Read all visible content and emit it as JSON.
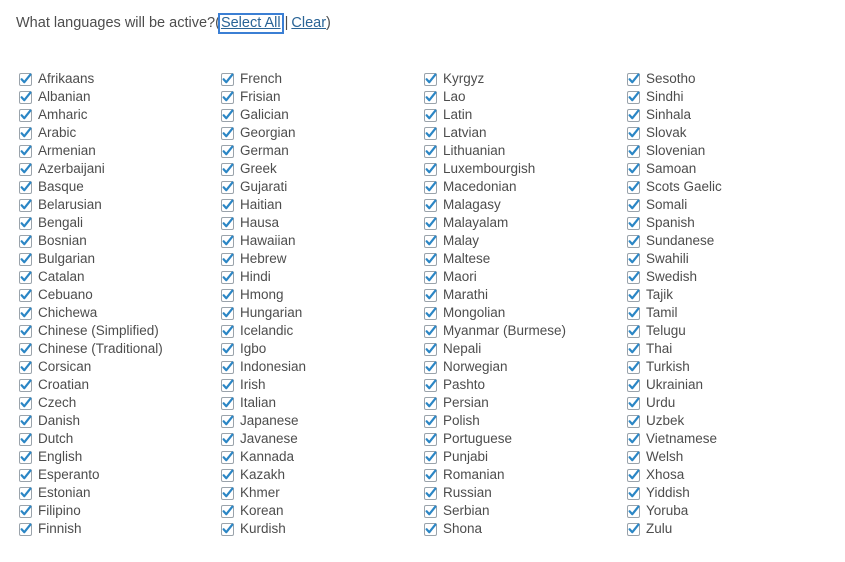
{
  "prompt": {
    "question": "What languages will be active?",
    "open_paren": "(",
    "select_all_label": "Select All",
    "separator": "|",
    "clear_label": "Clear",
    "close_paren": ")"
  },
  "colors": {
    "link": "#2a6496",
    "text": "#4d4d4d",
    "checkmark": "#2b86c5",
    "checkbox_border": "#9aa3ab",
    "focus_ring": "#3b7fd4",
    "background": "#ffffff"
  },
  "checkbox_state": {
    "checked": true,
    "icon": "checkmark-icon"
  },
  "columns": [
    {
      "index": 0,
      "items": [
        {
          "label": "Afrikaans",
          "checked": true
        },
        {
          "label": "Albanian",
          "checked": true
        },
        {
          "label": "Amharic",
          "checked": true
        },
        {
          "label": "Arabic",
          "checked": true
        },
        {
          "label": "Armenian",
          "checked": true
        },
        {
          "label": "Azerbaijani",
          "checked": true
        },
        {
          "label": "Basque",
          "checked": true
        },
        {
          "label": "Belarusian",
          "checked": true
        },
        {
          "label": "Bengali",
          "checked": true
        },
        {
          "label": "Bosnian",
          "checked": true
        },
        {
          "label": "Bulgarian",
          "checked": true
        },
        {
          "label": "Catalan",
          "checked": true
        },
        {
          "label": "Cebuano",
          "checked": true
        },
        {
          "label": "Chichewa",
          "checked": true
        },
        {
          "label": "Chinese (Simplified)",
          "checked": true
        },
        {
          "label": "Chinese (Traditional)",
          "checked": true
        },
        {
          "label": "Corsican",
          "checked": true
        },
        {
          "label": "Croatian",
          "checked": true
        },
        {
          "label": "Czech",
          "checked": true
        },
        {
          "label": "Danish",
          "checked": true
        },
        {
          "label": "Dutch",
          "checked": true
        },
        {
          "label": "English",
          "checked": true
        },
        {
          "label": "Esperanto",
          "checked": true
        },
        {
          "label": "Estonian",
          "checked": true
        },
        {
          "label": "Filipino",
          "checked": true
        },
        {
          "label": "Finnish",
          "checked": true
        }
      ]
    },
    {
      "index": 1,
      "items": [
        {
          "label": "French",
          "checked": true
        },
        {
          "label": "Frisian",
          "checked": true
        },
        {
          "label": "Galician",
          "checked": true
        },
        {
          "label": "Georgian",
          "checked": true
        },
        {
          "label": "German",
          "checked": true
        },
        {
          "label": "Greek",
          "checked": true
        },
        {
          "label": "Gujarati",
          "checked": true
        },
        {
          "label": "Haitian",
          "checked": true
        },
        {
          "label": "Hausa",
          "checked": true
        },
        {
          "label": "Hawaiian",
          "checked": true
        },
        {
          "label": "Hebrew",
          "checked": true
        },
        {
          "label": "Hindi",
          "checked": true
        },
        {
          "label": "Hmong",
          "checked": true
        },
        {
          "label": "Hungarian",
          "checked": true
        },
        {
          "label": "Icelandic",
          "checked": true
        },
        {
          "label": "Igbo",
          "checked": true
        },
        {
          "label": "Indonesian",
          "checked": true
        },
        {
          "label": "Irish",
          "checked": true
        },
        {
          "label": "Italian",
          "checked": true
        },
        {
          "label": "Japanese",
          "checked": true
        },
        {
          "label": "Javanese",
          "checked": true
        },
        {
          "label": "Kannada",
          "checked": true
        },
        {
          "label": "Kazakh",
          "checked": true
        },
        {
          "label": "Khmer",
          "checked": true
        },
        {
          "label": "Korean",
          "checked": true
        },
        {
          "label": "Kurdish",
          "checked": true
        }
      ]
    },
    {
      "index": 2,
      "items": [
        {
          "label": "Kyrgyz",
          "checked": true
        },
        {
          "label": "Lao",
          "checked": true
        },
        {
          "label": "Latin",
          "checked": true
        },
        {
          "label": "Latvian",
          "checked": true
        },
        {
          "label": "Lithuanian",
          "checked": true
        },
        {
          "label": "Luxembourgish",
          "checked": true
        },
        {
          "label": "Macedonian",
          "checked": true
        },
        {
          "label": "Malagasy",
          "checked": true
        },
        {
          "label": "Malayalam",
          "checked": true
        },
        {
          "label": "Malay",
          "checked": true
        },
        {
          "label": "Maltese",
          "checked": true
        },
        {
          "label": "Maori",
          "checked": true
        },
        {
          "label": "Marathi",
          "checked": true
        },
        {
          "label": "Mongolian",
          "checked": true
        },
        {
          "label": "Myanmar (Burmese)",
          "checked": true
        },
        {
          "label": "Nepali",
          "checked": true
        },
        {
          "label": "Norwegian",
          "checked": true
        },
        {
          "label": "Pashto",
          "checked": true
        },
        {
          "label": "Persian",
          "checked": true
        },
        {
          "label": "Polish",
          "checked": true
        },
        {
          "label": "Portuguese",
          "checked": true
        },
        {
          "label": "Punjabi",
          "checked": true
        },
        {
          "label": "Romanian",
          "checked": true
        },
        {
          "label": "Russian",
          "checked": true
        },
        {
          "label": "Serbian",
          "checked": true
        },
        {
          "label": "Shona",
          "checked": true
        }
      ]
    },
    {
      "index": 3,
      "items": [
        {
          "label": "Sesotho",
          "checked": true
        },
        {
          "label": "Sindhi",
          "checked": true
        },
        {
          "label": "Sinhala",
          "checked": true
        },
        {
          "label": "Slovak",
          "checked": true
        },
        {
          "label": "Slovenian",
          "checked": true
        },
        {
          "label": "Samoan",
          "checked": true
        },
        {
          "label": "Scots Gaelic",
          "checked": true
        },
        {
          "label": "Somali",
          "checked": true
        },
        {
          "label": "Spanish",
          "checked": true
        },
        {
          "label": "Sundanese",
          "checked": true
        },
        {
          "label": "Swahili",
          "checked": true
        },
        {
          "label": "Swedish",
          "checked": true
        },
        {
          "label": "Tajik",
          "checked": true
        },
        {
          "label": "Tamil",
          "checked": true
        },
        {
          "label": "Telugu",
          "checked": true
        },
        {
          "label": "Thai",
          "checked": true
        },
        {
          "label": "Turkish",
          "checked": true
        },
        {
          "label": "Ukrainian",
          "checked": true
        },
        {
          "label": "Urdu",
          "checked": true
        },
        {
          "label": "Uzbek",
          "checked": true
        },
        {
          "label": "Vietnamese",
          "checked": true
        },
        {
          "label": "Welsh",
          "checked": true
        },
        {
          "label": "Xhosa",
          "checked": true
        },
        {
          "label": "Yiddish",
          "checked": true
        },
        {
          "label": "Yoruba",
          "checked": true
        },
        {
          "label": "Zulu",
          "checked": true
        }
      ]
    }
  ]
}
